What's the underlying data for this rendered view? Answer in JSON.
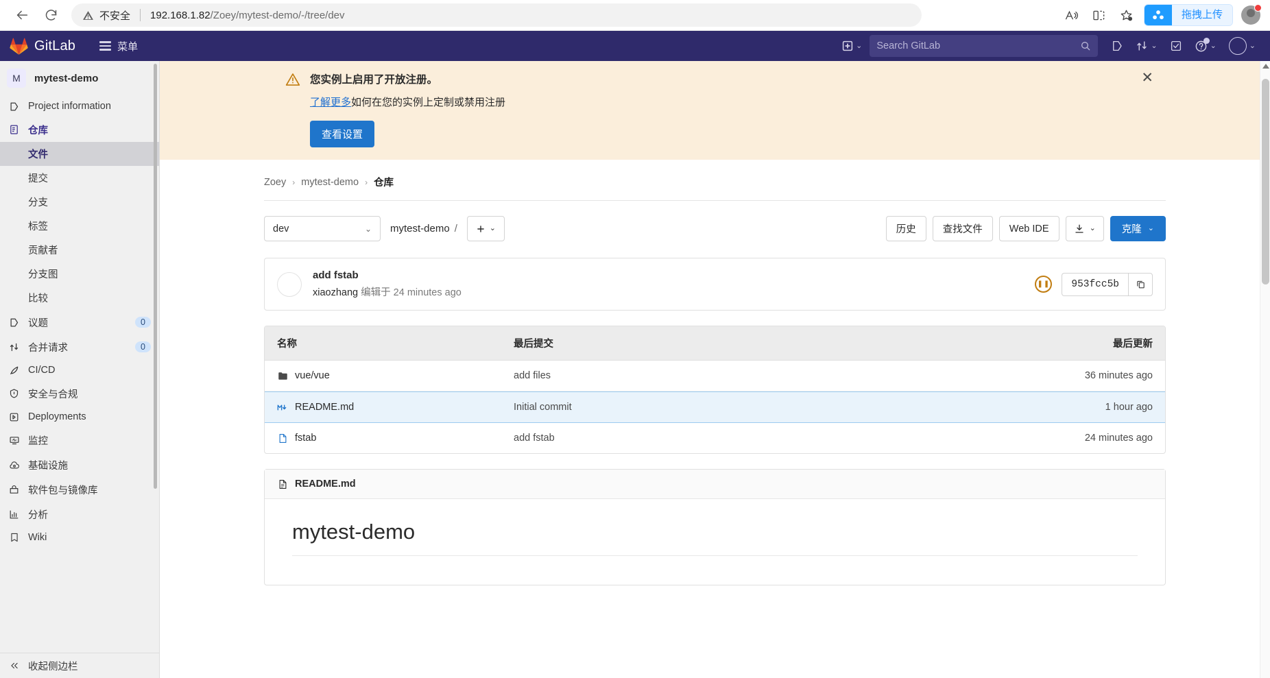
{
  "browser": {
    "back_icon": "arrow-left-icon",
    "reload_icon": "reload-icon",
    "insecure_label": "不安全",
    "url_host": "192.168.1.82",
    "url_path": "/Zoey/mytest-demo/-/tree/dev",
    "read_aloud_icon": "read-aloud-icon",
    "split_screen_icon": "split-screen-icon",
    "favorite_icon": "add-favorite-icon",
    "extension_label": "拖拽上传",
    "profile_icon": "profile-avatar-icon"
  },
  "gitlab_nav": {
    "brand": "GitLab",
    "menu_label": "菜单",
    "create_new_icon": "plus-square-icon",
    "search_placeholder": "Search GitLab",
    "search_icon": "search-icon",
    "issues_icon": "issues-icon",
    "merge_requests_icon": "merge-request-icon",
    "todos_icon": "todos-check-icon",
    "help_icon": "question-circle-icon",
    "user_avatar_icon": "user-avatar-icon"
  },
  "sidebar": {
    "project_initial": "M",
    "project_name": "mytest-demo",
    "items": [
      {
        "label": "Project information",
        "icon": "doc-info-icon",
        "type": "item"
      },
      {
        "label": "仓库",
        "icon": "repository-icon",
        "type": "item",
        "active_parent": true
      },
      {
        "label": "文件",
        "type": "sub",
        "active": true
      },
      {
        "label": "提交",
        "type": "sub"
      },
      {
        "label": "分支",
        "type": "sub"
      },
      {
        "label": "标签",
        "type": "sub"
      },
      {
        "label": "贡献者",
        "type": "sub"
      },
      {
        "label": "分支图",
        "type": "sub"
      },
      {
        "label": "比较",
        "type": "sub"
      },
      {
        "label": "议题",
        "icon": "issues-icon",
        "type": "item",
        "badge": "0"
      },
      {
        "label": "合并请求",
        "icon": "merge-request-icon",
        "type": "item",
        "badge": "0"
      },
      {
        "label": "CI/CD",
        "icon": "rocket-icon",
        "type": "item"
      },
      {
        "label": "安全与合规",
        "icon": "shield-icon",
        "type": "item"
      },
      {
        "label": "Deployments",
        "icon": "deployments-icon",
        "type": "item"
      },
      {
        "label": "监控",
        "icon": "monitor-icon",
        "type": "item"
      },
      {
        "label": "基础设施",
        "icon": "cloud-gear-icon",
        "type": "item"
      },
      {
        "label": "软件包与镜像库",
        "icon": "package-icon",
        "type": "item"
      },
      {
        "label": "分析",
        "icon": "chart-icon",
        "type": "item"
      },
      {
        "label": "Wiki",
        "icon": "book-icon",
        "type": "item"
      }
    ],
    "collapse_label": "收起侧边栏",
    "collapse_icon": "chevron-double-left-icon"
  },
  "alert": {
    "warning_icon": "warning-triangle-icon",
    "title": "您实例上启用了开放注册。",
    "link_text": "了解更多",
    "body_text": "如何在您的实例上定制或禁用注册",
    "button_label": "查看设置",
    "close_icon": "close-icon"
  },
  "breadcrumb": {
    "items": [
      "Zoey",
      "mytest-demo",
      "仓库"
    ],
    "separator": "›"
  },
  "toolbar": {
    "branch": "dev",
    "branch_chevron_icon": "chevron-down-icon",
    "path_project": "mytest-demo",
    "path_slash": "/",
    "plus_icon": "plus-icon",
    "history_label": "历史",
    "find_file_label": "查找文件",
    "web_ide_label": "Web IDE",
    "download_icon": "download-icon",
    "clone_label": "克隆"
  },
  "commit": {
    "title": "add fstab",
    "author": "xiaozhang",
    "action_text": "编辑于",
    "time": "24 minutes ago",
    "pipeline_icon": "pipeline-pending-icon",
    "sha": "953fcc5b",
    "copy_icon": "copy-icon",
    "avatar_icon": "avatar-icon"
  },
  "file_table": {
    "headers": {
      "name": "名称",
      "commit": "最后提交",
      "updated": "最后更新"
    },
    "rows": [
      {
        "name": "vue/vue",
        "icon": "folder-icon",
        "commit": "add files",
        "updated": "36 minutes ago",
        "highlight": false
      },
      {
        "name": "README.md",
        "icon": "markdown-icon",
        "commit": "Initial commit",
        "updated": "1 hour ago",
        "highlight": true
      },
      {
        "name": "fstab",
        "icon": "file-icon",
        "commit": "add fstab",
        "updated": "24 minutes ago",
        "highlight": false
      }
    ]
  },
  "readme": {
    "filename": "README.md",
    "file_icon": "doc-icon",
    "heading": "mytest-demo"
  }
}
